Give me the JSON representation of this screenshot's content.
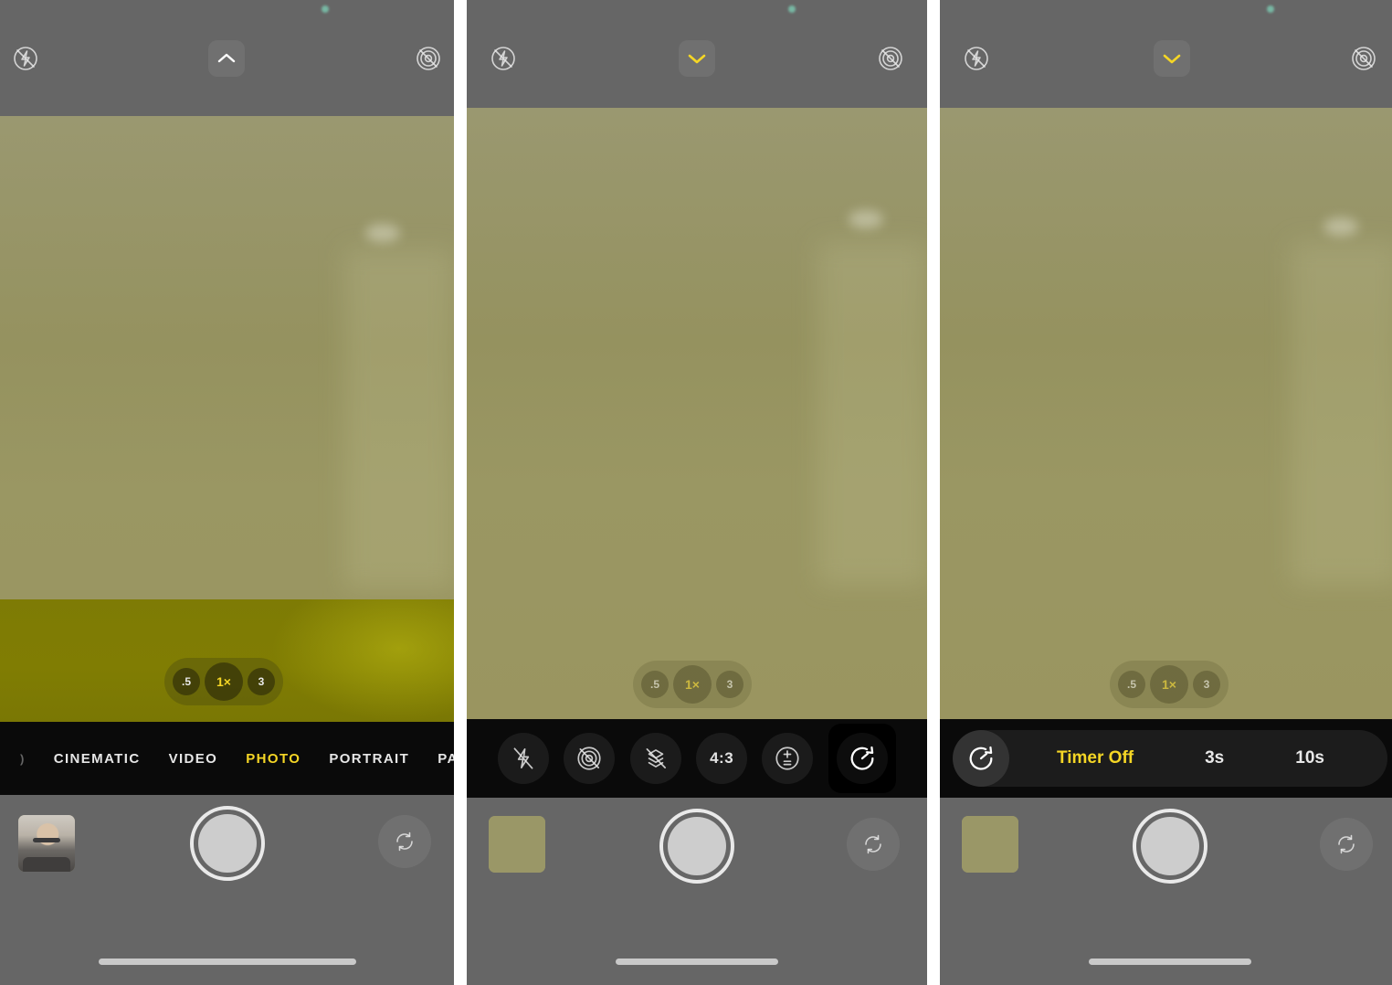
{
  "app": {
    "name": "Camera",
    "platform": "iOS"
  },
  "panels": [
    {
      "id": "panel-photo-mode",
      "top_bar": {
        "flash_icon": "flash-off-icon",
        "chevron_icon": "chevron-up-icon",
        "chevron_state": "collapsed",
        "live_photo_icon": "live-photo-off-icon",
        "privacy_dot": "green-camera-indicator"
      },
      "zoom": {
        "options": [
          {
            "label": ".5",
            "selected": false
          },
          {
            "label": "1×",
            "selected": true
          },
          {
            "label": "3",
            "selected": false
          }
        ]
      },
      "mode_strip": {
        "modes": [
          {
            "label": "CINEMATIC",
            "selected": false
          },
          {
            "label": "VIDEO",
            "selected": false
          },
          {
            "label": "PHOTO",
            "selected": true
          },
          {
            "label": "PORTRAIT",
            "selected": false
          },
          {
            "label": "PANO",
            "selected": false
          }
        ]
      },
      "bottom_bar": {
        "thumbnail": "photo-thumbnail-person",
        "shutter": "shutter-button",
        "flip_icon": "camera-flip-icon"
      }
    },
    {
      "id": "panel-controls-expanded",
      "top_bar": {
        "flash_icon": "flash-off-icon",
        "chevron_icon": "chevron-down-icon",
        "chevron_state": "expanded",
        "live_photo_icon": "live-photo-off-icon",
        "privacy_dot": "green-camera-indicator"
      },
      "zoom": {
        "options": [
          {
            "label": ".5",
            "selected": false
          },
          {
            "label": "1×",
            "selected": true
          },
          {
            "label": "3",
            "selected": false
          }
        ]
      },
      "controls": [
        {
          "name": "flash-off-icon",
          "label": "",
          "selected": false
        },
        {
          "name": "live-photo-off-icon",
          "label": "",
          "selected": false
        },
        {
          "name": "raw-off-icon",
          "label": "",
          "selected": false
        },
        {
          "name": "aspect-ratio-button",
          "label": "4:3",
          "selected": false
        },
        {
          "name": "exposure-icon",
          "label": "",
          "selected": false
        },
        {
          "name": "timer-icon",
          "label": "",
          "selected": true
        }
      ],
      "bottom_bar": {
        "thumbnail": "photo-thumbnail-olive",
        "shutter": "shutter-button",
        "flip_icon": "camera-flip-icon"
      }
    },
    {
      "id": "panel-timer-options",
      "top_bar": {
        "flash_icon": "flash-off-icon",
        "chevron_icon": "chevron-down-icon",
        "chevron_state": "expanded",
        "live_photo_icon": "live-photo-off-icon",
        "privacy_dot": "green-camera-indicator"
      },
      "zoom": {
        "options": [
          {
            "label": ".5",
            "selected": false
          },
          {
            "label": "1×",
            "selected": true
          },
          {
            "label": "3",
            "selected": false
          }
        ]
      },
      "timer": {
        "icon": "timer-icon",
        "options": [
          {
            "label": "Timer Off",
            "selected": true
          },
          {
            "label": "3s",
            "selected": false
          },
          {
            "label": "10s",
            "selected": false
          }
        ]
      },
      "bottom_bar": {
        "thumbnail": "photo-thumbnail-olive",
        "shutter": "shutter-button",
        "flip_icon": "camera-flip-icon"
      }
    }
  ],
  "colors": {
    "chrome": "#666666",
    "strip": "#0a0a0a",
    "viewfinder": "#969367",
    "highlight_band": "#807d03",
    "accent_yellow": "#f5d625",
    "text_white": "#e8e8e8",
    "privacy_green": "#77b7a3"
  }
}
